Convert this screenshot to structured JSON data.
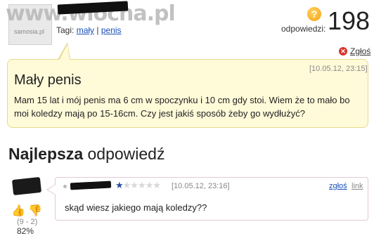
{
  "watermark": "www.wiocha.pl",
  "question": {
    "avatar_label": "samosia.pl",
    "tags_label": "Tagi:",
    "tags": [
      "mały",
      "penis"
    ],
    "answers_label": "odpowiedzi:",
    "answers_count": "198",
    "report_label": "Zgłoś",
    "date": "[10.05.12, 23:15]",
    "title": "Mały penis",
    "body": "Mam 15 lat i mój penis ma 6 cm w spoczynku i 10 cm gdy stoi. Wiem że to mało bo moi koledzy mają po 15-16cm. Czy jest jakiś sposób żeby go wydłużyć?"
  },
  "best_answer": {
    "heading_bold": "Najlepsza",
    "heading_rest": "odpowiedź",
    "stars_on": "★",
    "stars_off": "★★★★★",
    "date": "[10.05.12, 23:16]",
    "report_label": "zgłoś",
    "link_label": "link",
    "body": "skąd wiesz jakiego mają koledzy??",
    "votes": "(9 - 2)",
    "percent": "82%"
  },
  "colors": {
    "question_bg": "#fffbd9",
    "link": "#1a4fb8",
    "report_icon": "#d9332b"
  }
}
